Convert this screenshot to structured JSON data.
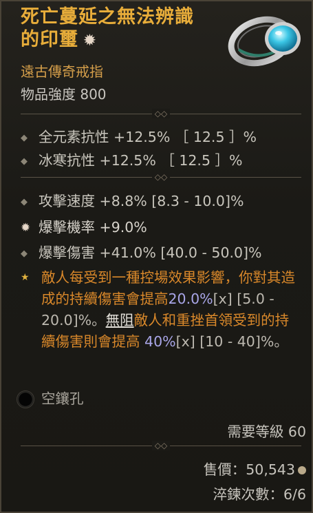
{
  "item": {
    "name_line1": "死亡蔓延之無法辨識",
    "name_line2": "的印璽",
    "name_badge_icon": "ancestral-star-icon",
    "type": "遠古傳奇戒指",
    "power_label": "物品強度 800"
  },
  "implicits": [
    {
      "text": "全元素抗性 +12.5% ［ 12.5 ］%"
    },
    {
      "text": "冰寒抗性 +12.5% ［ 12.5 ］%"
    }
  ],
  "affixes": [
    {
      "text": "攻擊速度 +8.8% [8.3 - 10.0]%",
      "icon": "diamond-bullet-icon"
    },
    {
      "text": "爆擊機率 +9.0%",
      "icon": "greater-affix-star-icon"
    },
    {
      "text": "爆擊傷害 +41.0% [40.0 - 50.0]%",
      "icon": "diamond-bullet-icon"
    }
  ],
  "legendary": {
    "part1": "敵人每受到一種控場效果影響，你對其造成的持續傷害會提高",
    "value1": "20.0%",
    "range1": "[x] [5.0 - 20.0]%。",
    "keyword": "無阻",
    "part2": "敵人和重挫",
    "part3": "首領受到的持續傷害則會提高 ",
    "value2": "40%",
    "range2": "[x] [10 - 40]%。"
  },
  "socket": {
    "label": "空鑲孔"
  },
  "requirements": {
    "level": "需要等級 60"
  },
  "footer": {
    "price": "售價：50,543",
    "temper": "淬鍊次數：6/6"
  },
  "colors": {
    "title": "#e8ad3a",
    "legendary": "#d9882a",
    "value_blue": "#a9a6e8"
  }
}
